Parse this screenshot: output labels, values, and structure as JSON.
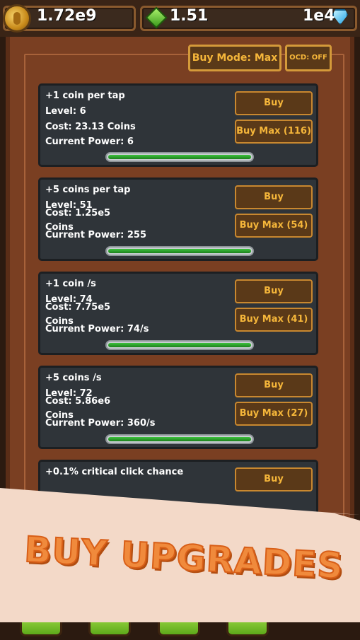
{
  "top_bar": {
    "coins": "1.72e9",
    "green_gems": "1.51",
    "blue_gems": "1e4"
  },
  "header": {
    "buy_mode_label": "Buy Mode: Max",
    "ocd_label": "OCD: OFF"
  },
  "upgrades": [
    {
      "title": "+1 coin per tap",
      "level": "Level: 6",
      "cost": "Cost: 23.13 Coins",
      "cost_unit": "",
      "power": "Current Power: 6",
      "buy_label": "Buy",
      "max_label": "Buy Max (116)",
      "progress": 1.0
    },
    {
      "title": "+5 coins per tap",
      "level": "Level: 51",
      "cost": "Cost: 1.25e5",
      "cost_unit": "Coins",
      "power": "Current Power: 255",
      "buy_label": "Buy",
      "max_label": "Buy Max (54)",
      "progress": 1.0
    },
    {
      "title": "+1 coin /s",
      "level": "Level: 74",
      "cost": "Cost: 7.75e5",
      "cost_unit": "Coins",
      "power": "Current Power: 74/s",
      "buy_label": "Buy",
      "max_label": "Buy Max (41)",
      "progress": 1.0
    },
    {
      "title": "+5 coins /s",
      "level": "Level: 72",
      "cost": "Cost: 5.86e6",
      "cost_unit": "Coins",
      "power": "Current Power: 360/s",
      "buy_label": "Buy",
      "max_label": "Buy Max (27)",
      "progress": 1.0
    },
    {
      "title": "+0.1% critical click chance",
      "level": "",
      "cost": "",
      "cost_unit": "",
      "power": "",
      "buy_label": "Buy",
      "max_label": "",
      "progress": 1.0
    }
  ],
  "banner": {
    "text": "BUY UPGRADES"
  },
  "colors": {
    "panel": "#7a3f22",
    "card": "#2f3439",
    "button_text": "#f5b63a",
    "banner_text": "#f08a3c"
  }
}
